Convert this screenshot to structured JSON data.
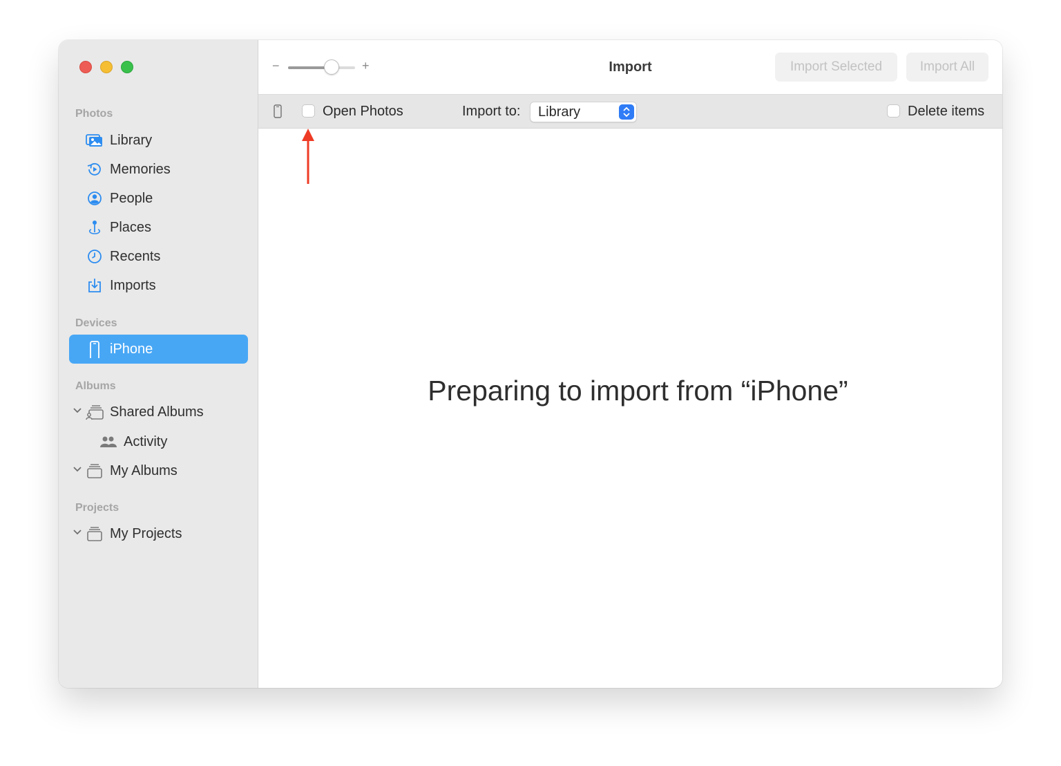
{
  "sidebar": {
    "sections": {
      "photos": "Photos",
      "devices": "Devices",
      "albums": "Albums",
      "projects": "Projects"
    },
    "items": {
      "library": "Library",
      "memories": "Memories",
      "people": "People",
      "places": "Places",
      "recents": "Recents",
      "imports": "Imports",
      "iphone": "iPhone",
      "shared_albums": "Shared Albums",
      "activity": "Activity",
      "my_albums": "My Albums",
      "my_projects": "My Projects"
    },
    "selected_item": "iPhone"
  },
  "toolbar": {
    "title": "Import",
    "zoom_minus": "−",
    "zoom_plus": "+",
    "zoom_level": 0.65,
    "import_selected_label": "Import Selected",
    "import_all_label": "Import All"
  },
  "options": {
    "open_photos_label": "Open Photos",
    "open_photos_checked": false,
    "import_to_label": "Import to:",
    "import_to_value": "Library",
    "delete_items_label": "Delete items",
    "delete_items_checked": false
  },
  "content": {
    "status_message": "Preparing to import from “iPhone”"
  },
  "colors": {
    "accent": "#48a7f5",
    "select_arrow": "#2f7cf6",
    "annotation_arrow": "#ee3b25",
    "icon_blue": "#2c8cf0"
  }
}
